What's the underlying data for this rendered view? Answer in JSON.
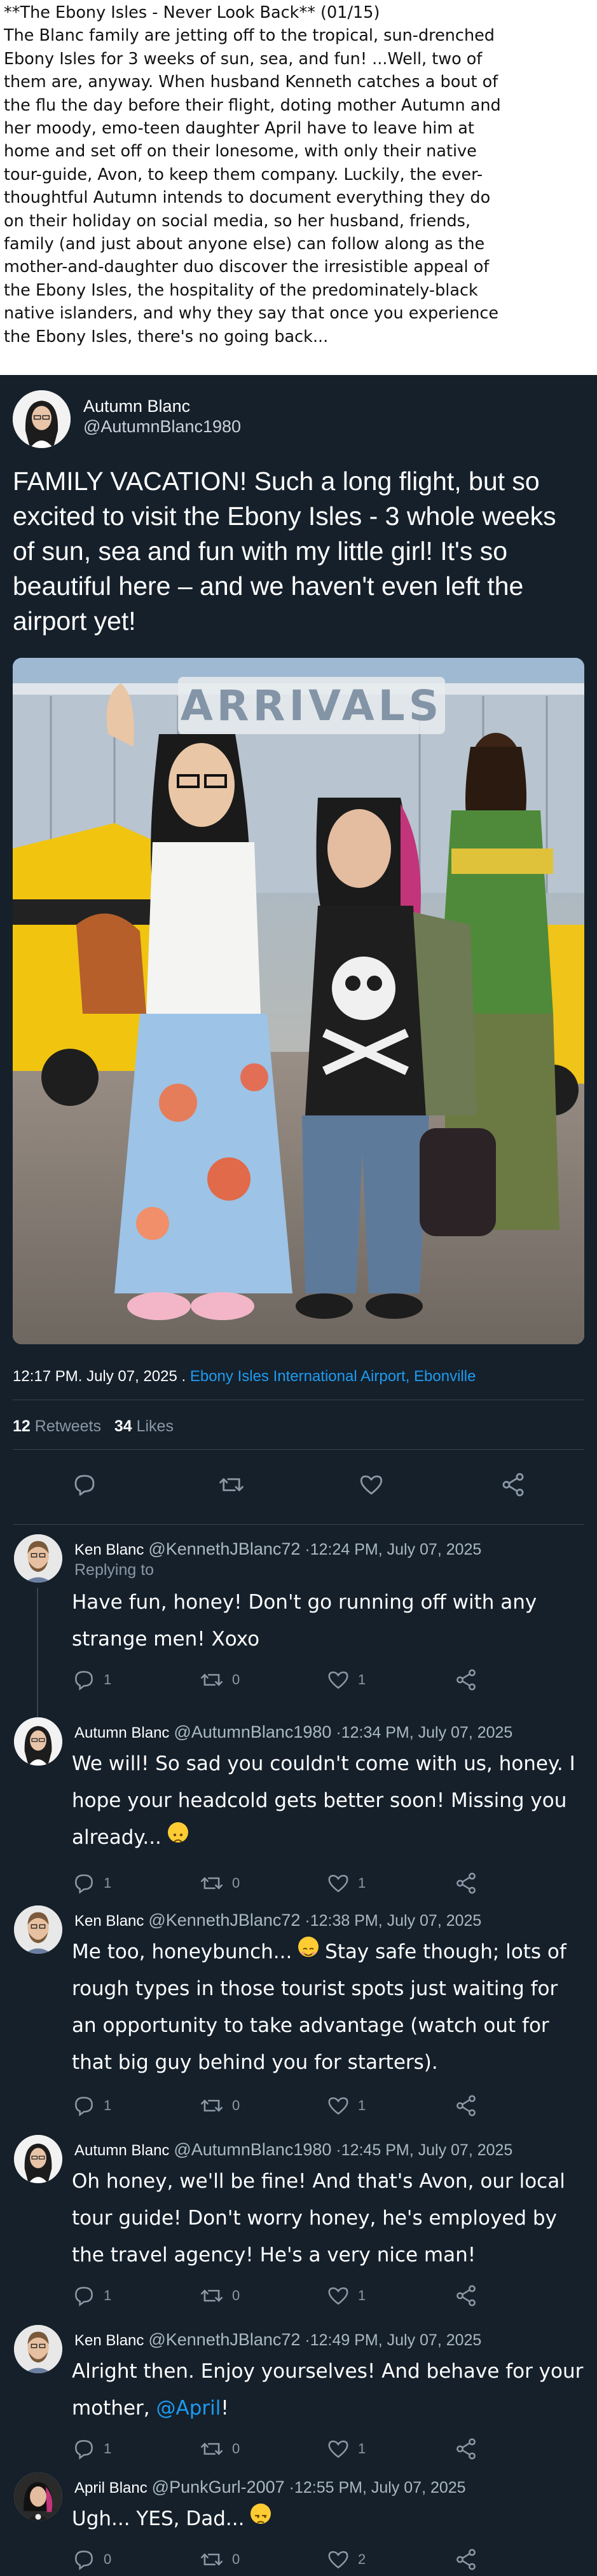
{
  "intro": {
    "text": "**The Ebony Isles - Never Look Back** (01/15)\nThe Blanc family are jetting off to the tropical, sun-drenched\nEbony Isles for 3 weeks of sun, sea, and fun! ...Well, two of\nthem are, anyway. When husband Kenneth catches a bout of\nthe flu the day before their flight, doting mother Autumn and\nher moody, emo-teen daughter April have to leave him at\nhome and set off on their lonesome, with only their native\ntour-guide, Avon, to keep them company. Luckily, the ever-\nthoughtful Autumn intends to document everything they do\non their holiday on social media, so her husband, friends,\nfamily (and just about anyone else) can follow along as the\nmother-and-daughter duo discover the irresistible appeal of\nthe Ebony Isles, the hospitality of the predominately-black\nnative islanders, and why they say that once you experience\nthe Ebony Isles, there's no going back..."
  },
  "tweet": {
    "author_name": "Autumn Blanc",
    "author_handle": "@AutumnBlanc1980",
    "text": "FAMILY VACATION! Such a long flight, but so excited to visit the Ebony Isles - 3 whole weeks of sun, sea and fun with my little girl! It's so beautiful here – and we haven't even left the airport yet!",
    "photo_sign_text": "ARRIVALS",
    "time": "12:17 PM. July 07, 2025 .",
    "location": "Ebony Isles International Airport, Ebonville",
    "retweets_count": "12",
    "retweets_label": "Retweets",
    "likes_count": "34",
    "likes_label": "Likes"
  },
  "replies": [
    {
      "name": "Ken Blanc",
      "handle": "@KennethJBlanc72",
      "time": "·12:24 PM, July 07, 2025",
      "replying": "Replying to",
      "text": "Have fun, honey! Don't go running off with any strange men! Xoxo",
      "replies": "1",
      "retweets": "0",
      "likes": "1"
    },
    {
      "name": "Autumn Blanc",
      "handle": "@AutumnBlanc1980",
      "time": "·12:34 PM, July 07, 2025",
      "text": "We will! So sad you couldn't come with us, honey. I hope your headcold gets better soon! Missing you already...",
      "emoji": "sad-face-emoji",
      "replies": "1",
      "retweets": "0",
      "likes": "1"
    },
    {
      "name": "Ken Blanc",
      "handle": "@KennethJBlanc72",
      "time": "·12:38 PM, July 07, 2025",
      "text_before": "Me too, honeybunch...",
      "emoji": "smiling-face-emoji",
      "text_after": "Stay safe though; lots of rough types in those tourist spots just waiting for an opportunity to take advantage (watch out for that big guy behind you for starters).",
      "replies": "1",
      "retweets": "0",
      "likes": "1"
    },
    {
      "name": "Autumn Blanc",
      "handle": "@AutumnBlanc1980",
      "time": "·12:45 PM, July 07, 2025",
      "text": "Oh honey, we'll be fine! And that's Avon, our local tour guide! Don't worry honey, he's employed by the travel agency! He's a very nice man!",
      "replies": "1",
      "retweets": "0",
      "likes": "1"
    },
    {
      "name": "Ken Blanc",
      "handle": "@KennethJBlanc72",
      "time": "·12:49 PM, July 07, 2025",
      "text_before": "Alright then. Enjoy yourselves! And behave for your mother,",
      "mention": "@April",
      "text_after": "!",
      "replies": "1",
      "retweets": "0",
      "likes": "1"
    },
    {
      "name": "April Blanc",
      "handle": "@PunkGurl-2007",
      "time": "·12:55 PM, July 07, 2025",
      "text": "Ugh... YES, Dad...",
      "emoji": "unamused-face-emoji",
      "replies": "0",
      "retweets": "0",
      "likes": "2"
    }
  ],
  "icons": {
    "reply": "reply-icon",
    "retweet": "retweet-icon",
    "like": "heart-icon",
    "share": "share-icon"
  },
  "colors": {
    "background": "#15202b",
    "link": "#1d9bf0",
    "muted": "#8b98a5",
    "divider": "#38444d"
  }
}
